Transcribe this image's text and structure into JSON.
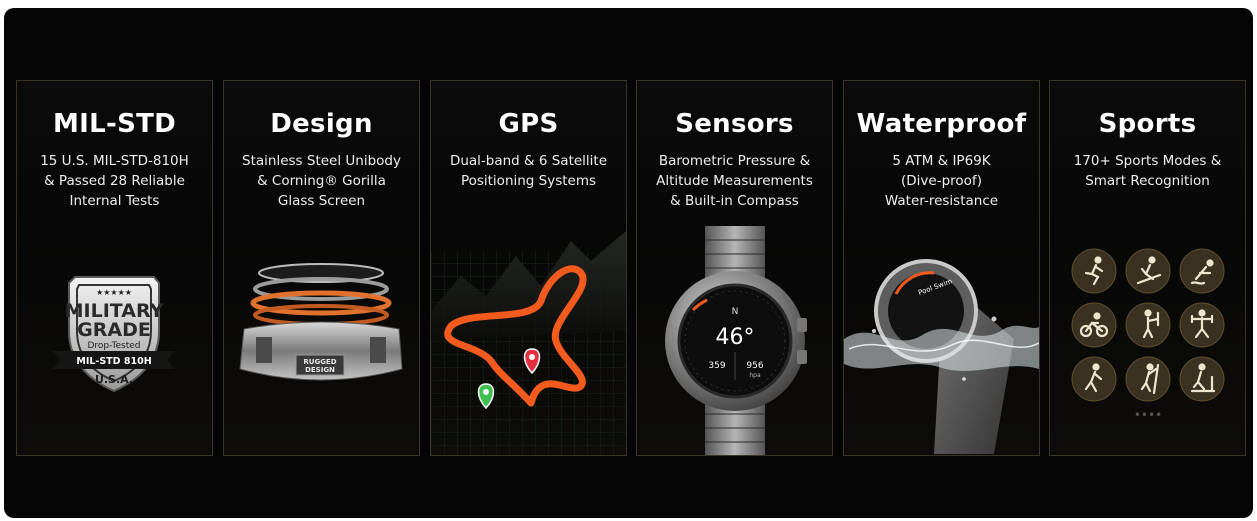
{
  "cards": [
    {
      "title": "MIL-STD",
      "lines": [
        "15 U.S. MIL-STD-810H",
        "& Passed 28 Reliable",
        "Internal Tests"
      ],
      "badge": {
        "stars": "★★★★★",
        "line1": "MILITARY",
        "line2": "GRADE",
        "line3": "Drop-Tested",
        "ribbon": "MIL-STD 810H",
        "bottom": "U.S.A."
      }
    },
    {
      "title": "Design",
      "lines": [
        "Stainless Steel Unibody",
        "& Corning® Gorilla",
        "Glass Screen"
      ],
      "plate1": "RUGGED",
      "plate2": "DESIGN"
    },
    {
      "title": "GPS",
      "lines": [
        "Dual-band & 6 Satellite",
        "Positioning Systems"
      ]
    },
    {
      "title": "Sensors",
      "lines": [
        "Barometric Pressure &",
        "Altitude Measurements",
        "& Built-in Compass"
      ],
      "watch": {
        "heading": "N",
        "temp": "46°",
        "left_value": "359",
        "right_value": "956",
        "right_unit": "hpa"
      }
    },
    {
      "title": "Waterproof",
      "lines": [
        "5 ATM & IP69K",
        "(Dive-proof)",
        "Water-resistance"
      ],
      "screen_text": "Pool Swim"
    },
    {
      "title": "Sports",
      "lines": [
        "170+ Sports Modes &",
        "Smart Recognition"
      ],
      "icons": [
        "running-icon",
        "skiing-icon",
        "swimming-icon",
        "cycling-icon",
        "weightlifting-icon",
        "fitness-icon",
        "hiking-icon",
        "climbing-icon",
        "treadmill-icon"
      ],
      "pager": "••••"
    }
  ],
  "colors": {
    "accent_orange": "#f25a1e",
    "icon_gold": "#3b3120",
    "pin_red": "#e2313e",
    "pin_green": "#3fbf4f"
  }
}
